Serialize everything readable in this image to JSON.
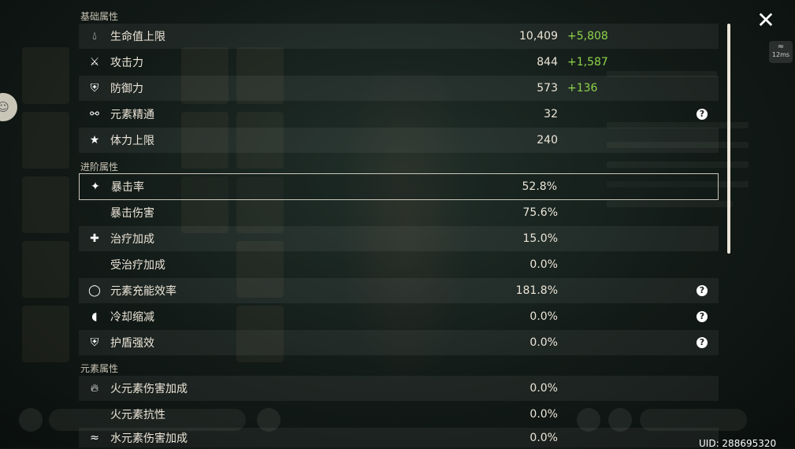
{
  "sections": {
    "basic_title": "基础属性",
    "advanced_title": "进阶属性",
    "element_title": "元素属性"
  },
  "basic": [
    {
      "label": "生命值上限",
      "base": "10,409",
      "bonus": "+5,808",
      "icon": "hp-drop-icon"
    },
    {
      "label": "攻击力",
      "base": "844",
      "bonus": "+1,587",
      "icon": "attack-sword-icon"
    },
    {
      "label": "防御力",
      "base": "573",
      "bonus": "+136",
      "icon": "defense-shield-icon"
    },
    {
      "label": "元素精通",
      "base": "32",
      "help": "?",
      "icon": "elemental-mastery-icon"
    },
    {
      "label": "体力上限",
      "base": "240",
      "icon": "stamina-icon"
    }
  ],
  "advanced": [
    {
      "label": "暴击率",
      "base": "52.8%",
      "icon": "crit-rate-icon"
    },
    {
      "label": "暴击伤害",
      "base": "75.6%"
    },
    {
      "label": "治疗加成",
      "base": "15.0%",
      "icon": "healing-cross-icon"
    },
    {
      "label": "受治疗加成",
      "base": "0.0%"
    },
    {
      "label": "元素充能效率",
      "base": "181.8%",
      "help": "?",
      "icon": "energy-recharge-icon"
    },
    {
      "label": "冷却缩减",
      "base": "0.0%",
      "help": "?",
      "icon": "cooldown-icon"
    },
    {
      "label": "护盾强效",
      "base": "0.0%",
      "help": "?",
      "icon": "shield-strength-icon"
    }
  ],
  "element": [
    {
      "label": "火元素伤害加成",
      "base": "0.0%",
      "icon": "pyro-icon"
    },
    {
      "label": "火元素抗性",
      "base": "0.0%"
    },
    {
      "label": "水元素伤害加成",
      "base": "0.0%",
      "icon": "hydro-icon"
    }
  ],
  "ui": {
    "close": "✕",
    "ping": "12ms",
    "uid": "UID: 288695320"
  },
  "colors": {
    "bonus_green": "#8fd44b",
    "text": "#ece5d8"
  }
}
